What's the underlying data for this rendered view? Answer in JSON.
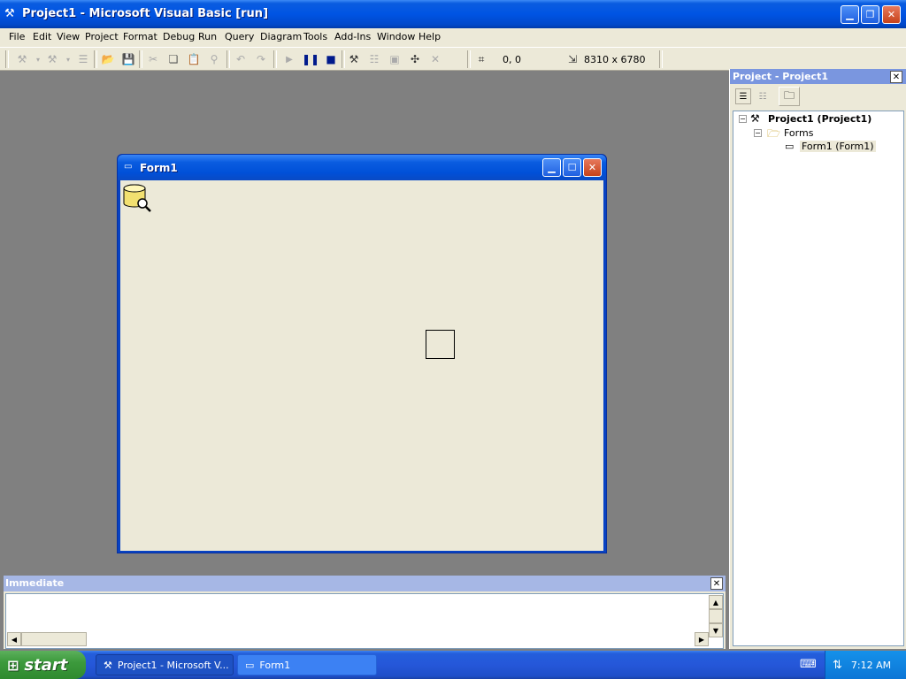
{
  "window": {
    "title": "Project1 - Microsoft Visual Basic [run]"
  },
  "menu": {
    "items": [
      "File",
      "Edit",
      "View",
      "Project",
      "Format",
      "Debug",
      "Run",
      "Query",
      "Diagram",
      "Tools",
      "Add-Ins",
      "Window",
      "Help"
    ]
  },
  "toolbar": {
    "position": "0, 0",
    "size": "8310 x 6780"
  },
  "form1": {
    "title": "Form1"
  },
  "project_panel": {
    "title": "Project - Project1",
    "tree": {
      "root": "Project1 (Project1)",
      "folder": "Forms",
      "item": "Form1 (Form1)"
    }
  },
  "immediate": {
    "title": "Immediate",
    "text": ""
  },
  "taskbar": {
    "start": "start",
    "tasks": [
      "Project1 - Microsoft V...",
      "Form1"
    ],
    "clock": "7:12 AM"
  }
}
